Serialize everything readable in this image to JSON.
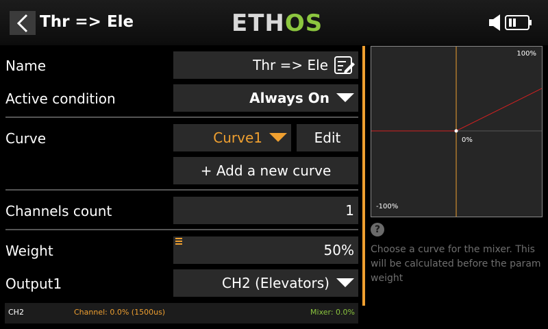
{
  "header": {
    "title": "Thr => Ele",
    "logo_part1": "ETH",
    "logo_part2": "OS"
  },
  "form": {
    "name": {
      "label": "Name",
      "value": "Thr => Ele"
    },
    "active_condition": {
      "label": "Active condition",
      "value": "Always On"
    },
    "curve": {
      "label": "Curve",
      "value": "Curve1",
      "edit_label": "Edit",
      "add_label": "+ Add a new curve"
    },
    "channels_count": {
      "label": "Channels count",
      "value": "1"
    },
    "weight": {
      "label": "Weight",
      "value": "50%"
    },
    "output1": {
      "label": "Output1",
      "value": "CH2 (Elevators)"
    }
  },
  "status_bar": {
    "channel_name": "CH2",
    "channel_info": "Channel: 0.0% (1500us)",
    "mixer_info": "Mixer: 0.0%"
  },
  "graph": {
    "top_label": "100%",
    "center_label": "0%",
    "bottom_label": "-100%"
  },
  "help": {
    "icon": "?",
    "text": "Choose a curve for the mixer. This will be calculated before the param weight"
  },
  "colors": {
    "accent": "#f0a030",
    "curve_line": "#d42020",
    "logo_green": "#8cc63f",
    "mixer_green": "#8cc63f"
  }
}
